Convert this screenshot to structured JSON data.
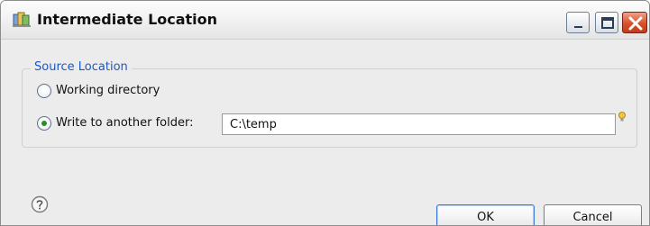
{
  "window": {
    "title": "Intermediate Location",
    "app_icon": "eclipse-books-icon",
    "controls": [
      "minimize-icon",
      "maximize-icon",
      "close-icon"
    ]
  },
  "source_location": {
    "legend": "Source Location",
    "options": [
      {
        "label": "Working directory",
        "selected": false
      },
      {
        "label": "Write to another folder:",
        "selected": true
      }
    ],
    "folder_value": "C:\\temp",
    "hint_icon": "lightbulb-icon"
  },
  "footer": {
    "help_icon": "help-icon",
    "ok_label": "OK",
    "cancel_label": "Cancel"
  },
  "colors": {
    "legend_text": "#1b58c4",
    "radio_dot": "#2c8c2c",
    "close_button": "#d9502b",
    "default_button_border": "#3d78d8"
  }
}
